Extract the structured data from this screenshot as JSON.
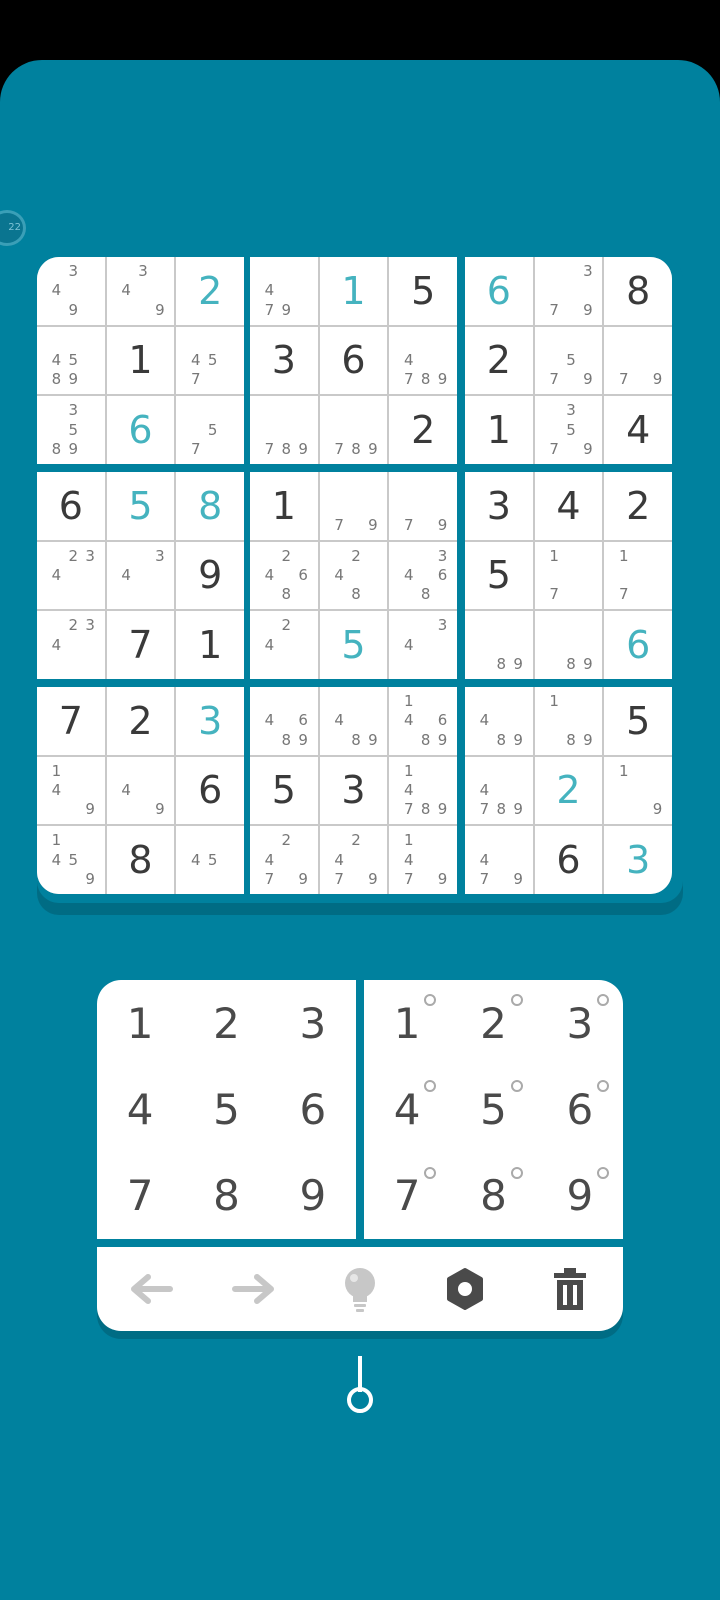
{
  "timer_badge": "22",
  "board": [
    [
      {
        "n": [
          null,
          "3",
          null,
          "4",
          null,
          null,
          null,
          "9",
          null
        ]
      },
      {
        "n": [
          null,
          "3",
          null,
          "4",
          null,
          null,
          null,
          null,
          "9"
        ]
      },
      {
        "v": "2",
        "t": "user"
      },
      {
        "n": [
          null,
          null,
          null,
          "4",
          null,
          null,
          "7",
          "9",
          null
        ]
      },
      {
        "v": "1",
        "t": "user"
      },
      {
        "v": "5",
        "t": "given"
      },
      {
        "v": "6",
        "t": "user"
      },
      {
        "n": [
          null,
          null,
          "3",
          null,
          null,
          null,
          "7",
          null,
          "9"
        ]
      },
      {
        "v": "8",
        "t": "given"
      }
    ],
    [
      {
        "n": [
          null,
          null,
          null,
          "4",
          "5",
          null,
          "8",
          "9",
          null
        ]
      },
      {
        "v": "1",
        "t": "given"
      },
      {
        "n": [
          null,
          null,
          null,
          "4",
          "5",
          null,
          "7",
          null,
          null
        ]
      },
      {
        "v": "3",
        "t": "given"
      },
      {
        "v": "6",
        "t": "given"
      },
      {
        "n": [
          null,
          null,
          null,
          "4",
          null,
          null,
          "7",
          "8",
          "9"
        ]
      },
      {
        "v": "2",
        "t": "given"
      },
      {
        "n": [
          null,
          null,
          null,
          null,
          "5",
          null,
          "7",
          null,
          "9"
        ]
      },
      {
        "n": [
          null,
          null,
          null,
          null,
          null,
          null,
          "7",
          null,
          "9"
        ]
      }
    ],
    [
      {
        "n": [
          null,
          "3",
          null,
          null,
          "5",
          null,
          "8",
          "9",
          null
        ]
      },
      {
        "v": "6",
        "t": "user"
      },
      {
        "n": [
          null,
          null,
          null,
          null,
          "5",
          null,
          "7",
          null,
          null
        ]
      },
      {
        "n": [
          null,
          null,
          null,
          null,
          null,
          null,
          "7",
          "8",
          "9"
        ]
      },
      {
        "n": [
          null,
          null,
          null,
          null,
          null,
          null,
          "7",
          "8",
          "9"
        ]
      },
      {
        "v": "2",
        "t": "given"
      },
      {
        "v": "1",
        "t": "given"
      },
      {
        "n": [
          null,
          "3",
          null,
          null,
          "5",
          null,
          "7",
          null,
          "9"
        ]
      },
      {
        "v": "4",
        "t": "given"
      }
    ],
    [
      {
        "v": "6",
        "t": "given"
      },
      {
        "v": "5",
        "t": "user"
      },
      {
        "v": "8",
        "t": "user"
      },
      {
        "v": "1",
        "t": "given"
      },
      {
        "n": [
          null,
          null,
          null,
          null,
          null,
          null,
          "7",
          null,
          "9"
        ]
      },
      {
        "n": [
          null,
          null,
          null,
          null,
          null,
          null,
          "7",
          null,
          "9"
        ]
      },
      {
        "v": "3",
        "t": "given"
      },
      {
        "v": "4",
        "t": "given"
      },
      {
        "v": "2",
        "t": "given"
      }
    ],
    [
      {
        "n": [
          null,
          "2",
          "3",
          "4",
          null,
          null,
          null,
          null,
          null
        ]
      },
      {
        "n": [
          null,
          null,
          "3",
          "4",
          null,
          null,
          null,
          null,
          null
        ]
      },
      {
        "v": "9",
        "t": "given"
      },
      {
        "n": [
          null,
          "2",
          null,
          "4",
          null,
          "6",
          null,
          "8",
          null
        ]
      },
      {
        "n": [
          null,
          "2",
          null,
          "4",
          null,
          null,
          null,
          "8",
          null
        ]
      },
      {
        "n": [
          null,
          null,
          "3",
          "4",
          null,
          "6",
          null,
          "8",
          null
        ]
      },
      {
        "v": "5",
        "t": "given"
      },
      {
        "n": [
          "1",
          null,
          null,
          null,
          null,
          null,
          "7",
          null,
          null
        ]
      },
      {
        "n": [
          "1",
          null,
          null,
          null,
          null,
          null,
          "7",
          null,
          null
        ]
      }
    ],
    [
      {
        "n": [
          null,
          "2",
          "3",
          "4",
          null,
          null,
          null,
          null,
          null
        ]
      },
      {
        "v": "7",
        "t": "given"
      },
      {
        "v": "1",
        "t": "given"
      },
      {
        "n": [
          null,
          "2",
          null,
          "4",
          null,
          null,
          null,
          null,
          null
        ]
      },
      {
        "v": "5",
        "t": "user"
      },
      {
        "n": [
          null,
          null,
          "3",
          "4",
          null,
          null,
          null,
          null,
          null
        ]
      },
      {
        "n": [
          null,
          null,
          null,
          null,
          null,
          null,
          null,
          "8",
          "9"
        ]
      },
      {
        "n": [
          null,
          null,
          null,
          null,
          null,
          null,
          null,
          "8",
          "9"
        ]
      },
      {
        "v": "6",
        "t": "user"
      }
    ],
    [
      {
        "v": "7",
        "t": "given"
      },
      {
        "v": "2",
        "t": "given"
      },
      {
        "v": "3",
        "t": "user"
      },
      {
        "n": [
          null,
          null,
          null,
          "4",
          null,
          "6",
          null,
          "8",
          "9"
        ]
      },
      {
        "n": [
          null,
          null,
          null,
          "4",
          null,
          null,
          null,
          "8",
          "9"
        ]
      },
      {
        "n": [
          "1",
          null,
          null,
          "4",
          null,
          "6",
          null,
          "8",
          "9"
        ]
      },
      {
        "n": [
          null,
          null,
          null,
          "4",
          null,
          null,
          null,
          "8",
          "9"
        ]
      },
      {
        "n": [
          "1",
          null,
          null,
          null,
          null,
          null,
          null,
          "8",
          "9"
        ]
      },
      {
        "v": "5",
        "t": "given"
      }
    ],
    [
      {
        "n": [
          "1",
          null,
          null,
          "4",
          null,
          null,
          null,
          null,
          "9"
        ]
      },
      {
        "n": [
          null,
          null,
          null,
          "4",
          null,
          null,
          null,
          null,
          "9"
        ]
      },
      {
        "v": "6",
        "t": "given"
      },
      {
        "v": "5",
        "t": "given"
      },
      {
        "v": "3",
        "t": "given"
      },
      {
        "n": [
          "1",
          null,
          null,
          "4",
          null,
          null,
          "7",
          "8",
          "9"
        ]
      },
      {
        "n": [
          null,
          null,
          null,
          "4",
          null,
          null,
          "7",
          "8",
          "9"
        ]
      },
      {
        "v": "2",
        "t": "user"
      },
      {
        "n": [
          "1",
          null,
          null,
          null,
          null,
          null,
          null,
          null,
          "9"
        ]
      }
    ],
    [
      {
        "n": [
          "1",
          null,
          null,
          "4",
          "5",
          null,
          null,
          null,
          "9"
        ]
      },
      {
        "v": "8",
        "t": "given"
      },
      {
        "n": [
          null,
          null,
          null,
          "4",
          "5",
          null,
          null,
          null,
          null
        ]
      },
      {
        "n": [
          null,
          "2",
          null,
          "4",
          null,
          null,
          "7",
          null,
          "9"
        ]
      },
      {
        "n": [
          null,
          "2",
          null,
          "4",
          null,
          null,
          "7",
          null,
          "9"
        ]
      },
      {
        "n": [
          "1",
          null,
          null,
          "4",
          null,
          null,
          "7",
          null,
          "9"
        ]
      },
      {
        "n": [
          null,
          null,
          null,
          "4",
          null,
          null,
          "7",
          null,
          "9"
        ]
      },
      {
        "v": "6",
        "t": "given"
      },
      {
        "v": "3",
        "t": "user"
      }
    ]
  ],
  "digit_pad": [
    "1",
    "2",
    "3",
    "4",
    "5",
    "6",
    "7",
    "8",
    "9"
  ],
  "notes_pad": [
    "1",
    "2",
    "3",
    "4",
    "5",
    "6",
    "7",
    "8",
    "9"
  ],
  "toolbar": {
    "items": [
      {
        "name": "undo-button",
        "icon": "arrow-left-icon"
      },
      {
        "name": "redo-button",
        "icon": "arrow-right-icon"
      },
      {
        "name": "hint-button",
        "icon": "lightbulb-icon"
      },
      {
        "name": "settings-button",
        "icon": "gear-icon"
      },
      {
        "name": "erase-button",
        "icon": "trash-icon"
      }
    ]
  },
  "colors": {
    "background": "#00819e",
    "user_digit": "#45b3bf",
    "given_digit": "#3a3a3a",
    "note": "#777777",
    "icon_disabled": "#c7c7c7",
    "icon_active": "#4a4a4a"
  }
}
